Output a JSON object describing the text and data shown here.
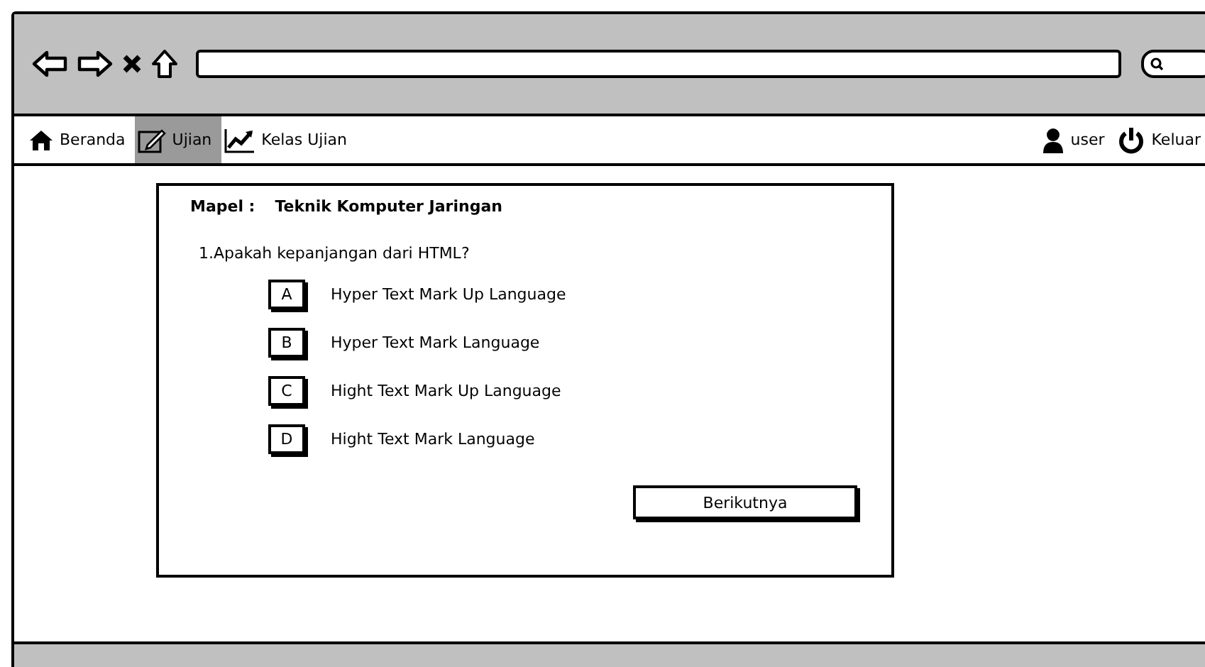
{
  "nav": {
    "items": [
      {
        "label": "Beranda",
        "selected": false
      },
      {
        "label": "Ujian",
        "selected": true
      },
      {
        "label": "Kelas Ujian",
        "selected": false
      }
    ],
    "user": "user",
    "logout": "Keluar"
  },
  "quiz": {
    "subject_label": "Mapel :",
    "subject": "Teknik Komputer Jaringan",
    "question": "1.Apakah kepanjangan dari HTML?",
    "options": [
      {
        "letter": "A",
        "text": "Hyper Text Mark Up Language"
      },
      {
        "letter": "B",
        "text": "Hyper Text Mark Language"
      },
      {
        "letter": "C",
        "text": "Hight Text Mark Up Language"
      },
      {
        "letter": "D",
        "text": "Hight Text Mark  Language"
      }
    ],
    "next_button": "Berikutnya"
  }
}
